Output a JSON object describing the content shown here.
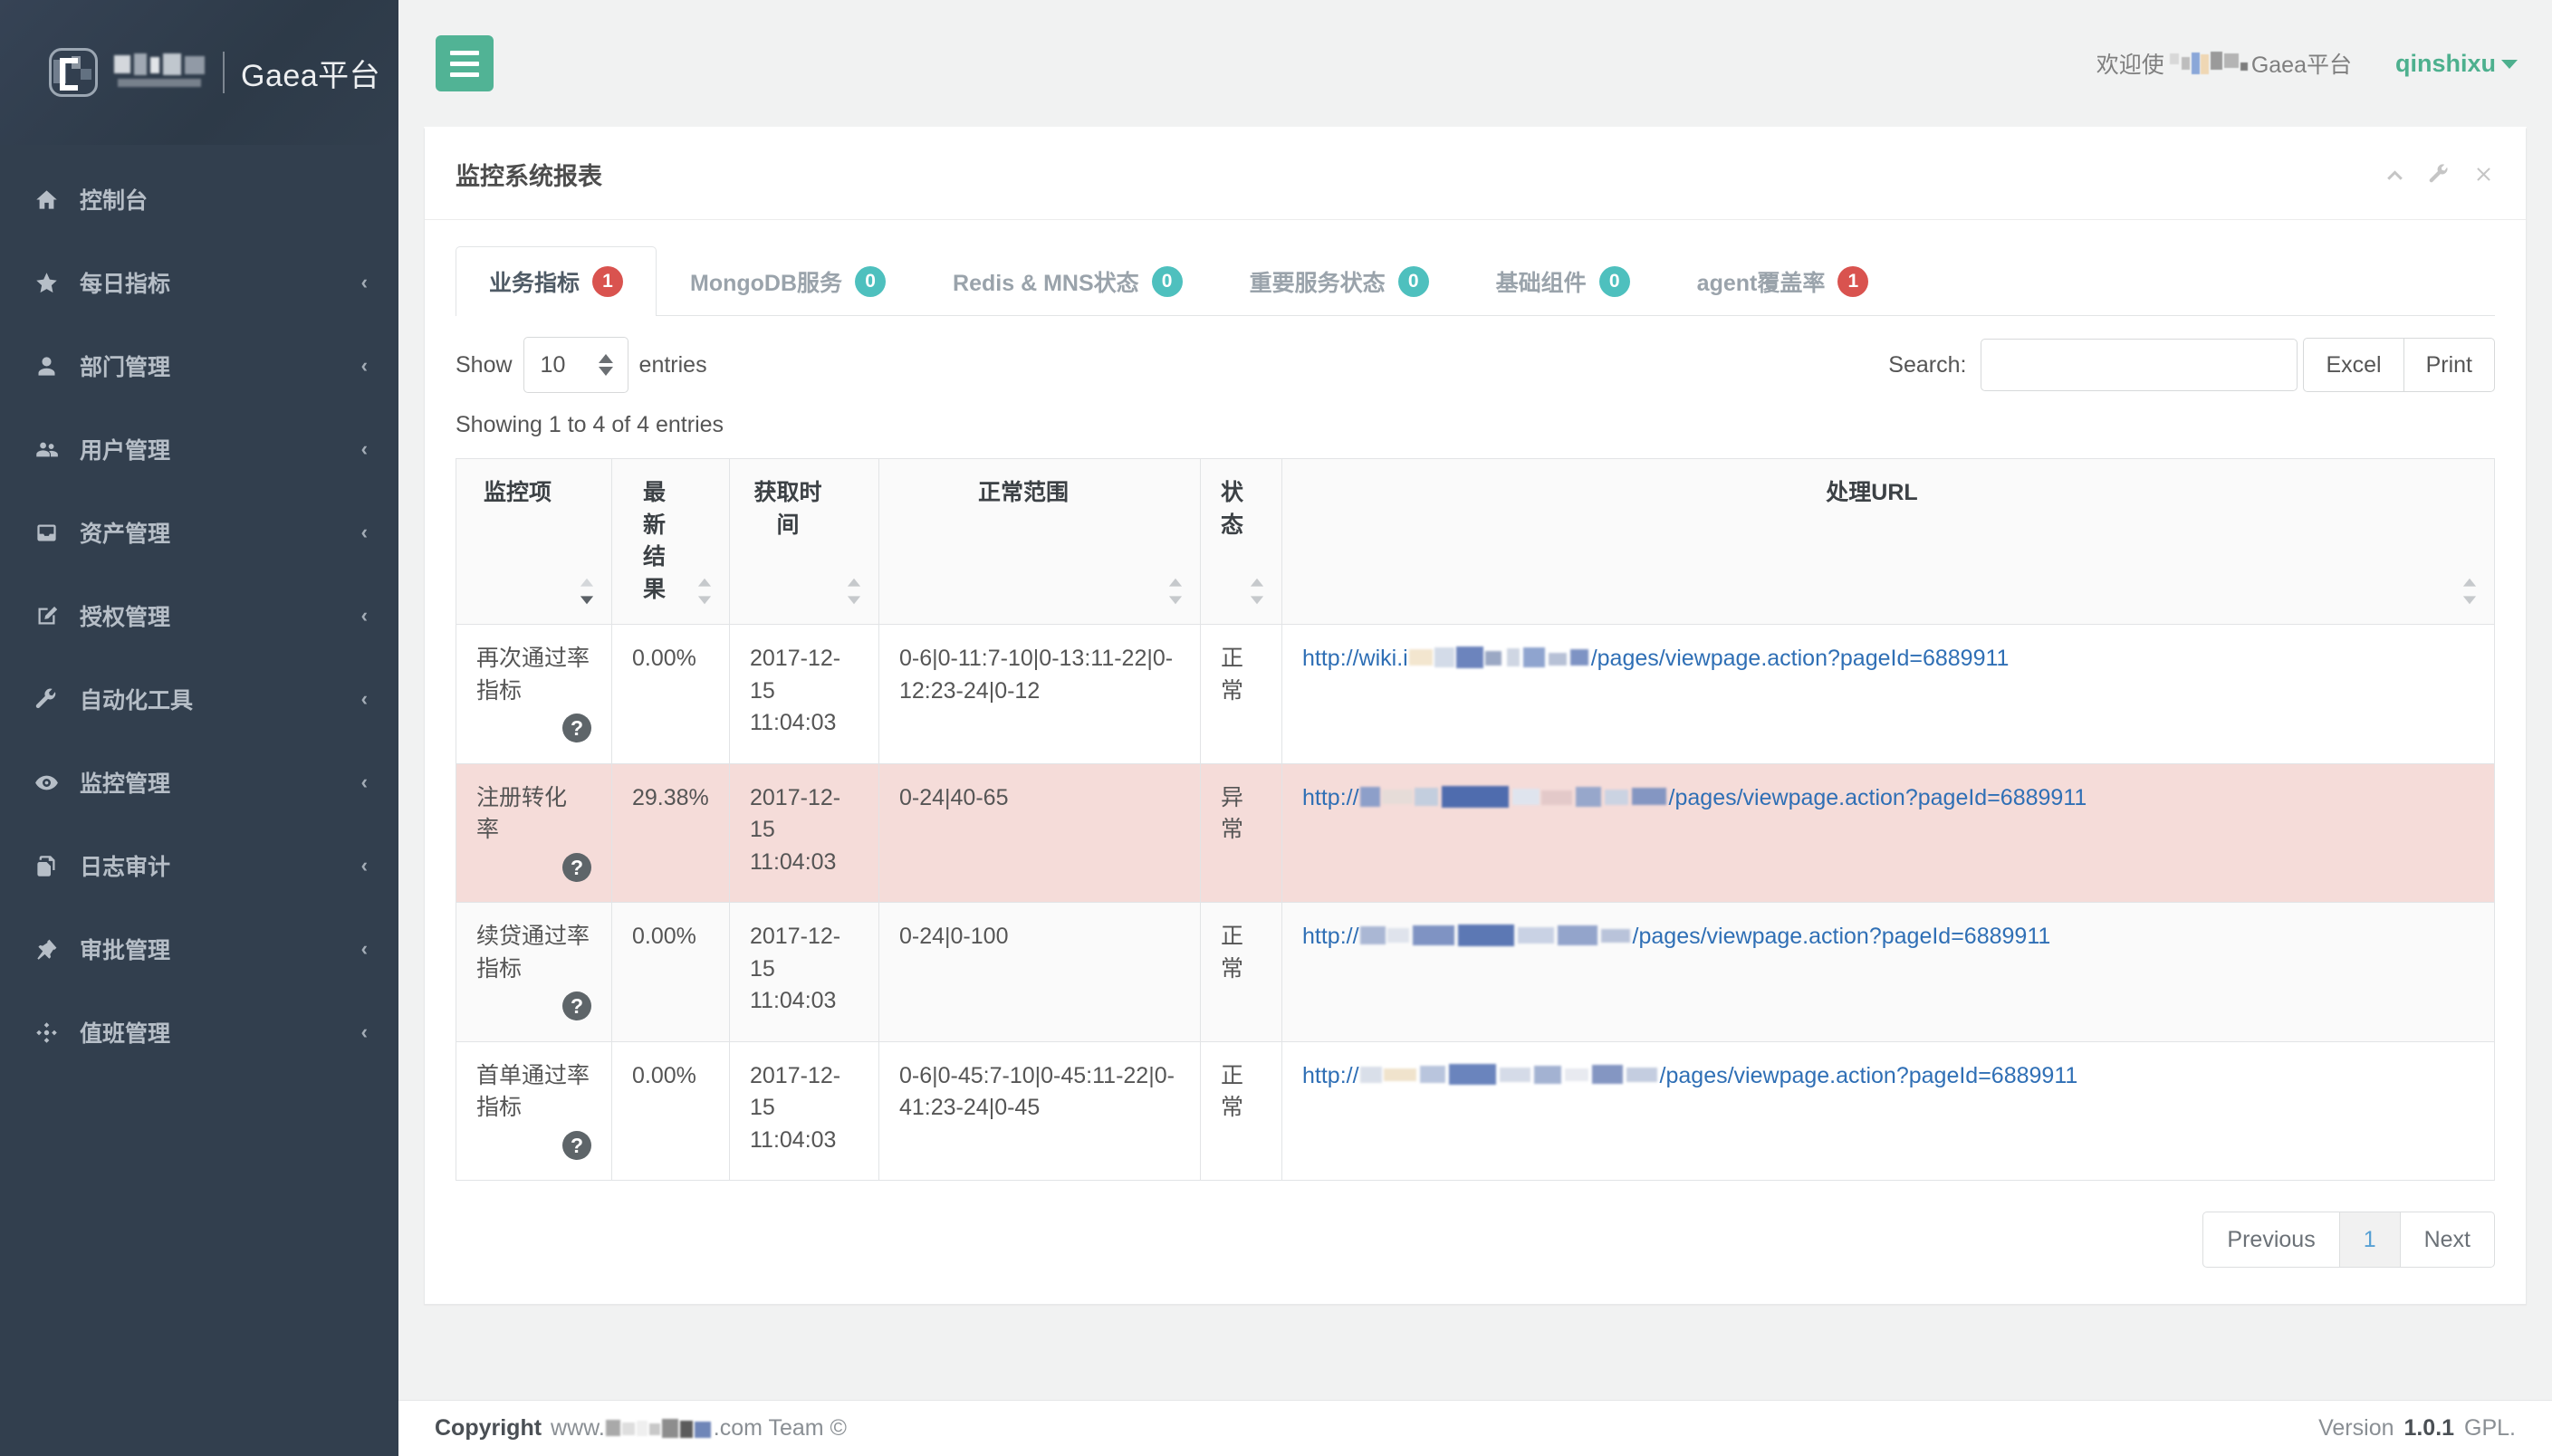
{
  "brand": {
    "name": "Gaea平台"
  },
  "sidebar": {
    "items": [
      {
        "label": "控制台",
        "icon": "home-icon",
        "expandable": false,
        "caret": ""
      },
      {
        "label": "每日指标",
        "icon": "star-icon",
        "expandable": true,
        "caret": "‹"
      },
      {
        "label": "部门管理",
        "icon": "user-icon",
        "expandable": true,
        "caret": "‹"
      },
      {
        "label": "用户管理",
        "icon": "users-icon",
        "expandable": true,
        "caret": "‹"
      },
      {
        "label": "资产管理",
        "icon": "inbox-icon",
        "expandable": true,
        "caret": "‹"
      },
      {
        "label": "授权管理",
        "icon": "edit-icon",
        "expandable": true,
        "caret": "‹"
      },
      {
        "label": "自动化工具",
        "icon": "wrench-icon",
        "expandable": true,
        "caret": "‹"
      },
      {
        "label": "监控管理",
        "icon": "eye-icon",
        "expandable": true,
        "caret": "‹"
      },
      {
        "label": "日志审计",
        "icon": "copy-icon",
        "expandable": true,
        "caret": "‹"
      },
      {
        "label": "审批管理",
        "icon": "pin-icon",
        "expandable": true,
        "caret": "‹"
      },
      {
        "label": "值班管理",
        "icon": "crosshair-icon",
        "expandable": true,
        "caret": "‹"
      }
    ]
  },
  "topbar": {
    "menu_toggle": "hamburger-icon",
    "welcome_prefix": "欢迎使",
    "welcome_suffix": "Gaea平台",
    "username": "qinshixu"
  },
  "panel": {
    "title": "监控系统报表",
    "tools": [
      {
        "name": "collapse-icon",
        "glyph": "chevron-up"
      },
      {
        "name": "settings-icon",
        "glyph": "wrench"
      },
      {
        "name": "close-icon",
        "glyph": "times"
      }
    ]
  },
  "tabs": [
    {
      "label": "业务指标",
      "count": "1",
      "badge": "red",
      "active": true
    },
    {
      "label": "MongoDB服务",
      "count": "0",
      "badge": "teal",
      "active": false
    },
    {
      "label": "Redis & MNS状态",
      "count": "0",
      "badge": "teal",
      "active": false
    },
    {
      "label": "重要服务状态",
      "count": "0",
      "badge": "teal",
      "active": false
    },
    {
      "label": "基础组件",
      "count": "0",
      "badge": "teal",
      "active": false
    },
    {
      "label": "agent覆盖率",
      "count": "1",
      "badge": "red",
      "active": false
    }
  ],
  "controls": {
    "show_label": "Show",
    "entries_label": "entries",
    "page_length": "10",
    "search_label": "Search:",
    "search_value": "",
    "search_placeholder": "",
    "excel_label": "Excel",
    "print_label": "Print",
    "info": "Showing 1 to 4 of 4 entries"
  },
  "table": {
    "columns": [
      {
        "label": "监控项",
        "sorted": true
      },
      {
        "label": "最新结果",
        "sorted": false
      },
      {
        "label": "获取时间",
        "sorted": false
      },
      {
        "label": "正常范围",
        "sorted": false
      },
      {
        "label": "状态",
        "sorted": false
      },
      {
        "label": "处理URL",
        "sorted": false
      }
    ],
    "rows": [
      {
        "name": "再次通过率指标",
        "help": "?",
        "result": "0.00%",
        "time": "2017-12-15 11:04:03",
        "range": "0-6|0-11:7-10|0-13:11-22|0-12:23-24|0-12",
        "status": "正常",
        "url_prefix": "http://wiki.i",
        "url_suffix": "/pages/viewpage.action?pageId=6889911",
        "style": "normal",
        "blur": "ub1"
      },
      {
        "name": "注册转化率",
        "help": "?",
        "result": "29.38%",
        "time": "2017-12-15 11:04:03",
        "range": "0-24|40-65",
        "status": "异常",
        "url_prefix": "http://",
        "url_suffix": "/pages/viewpage.action?pageId=6889911",
        "style": "danger",
        "blur": "ub2"
      },
      {
        "name": "续贷通过率指标",
        "help": "?",
        "result": "0.00%",
        "time": "2017-12-15 11:04:03",
        "range": "0-24|0-100",
        "status": "正常",
        "url_prefix": "http://",
        "url_suffix": "/pages/viewpage.action?pageId=6889911",
        "style": "alt",
        "blur": "ub3"
      },
      {
        "name": "首单通过率指标",
        "help": "?",
        "result": "0.00%",
        "time": "2017-12-15 11:04:03",
        "range": "0-6|0-45:7-10|0-45:11-22|0-41:23-24|0-45",
        "status": "正常",
        "url_prefix": "http://",
        "url_suffix": "/pages/viewpage.action?pageId=6889911",
        "style": "normal",
        "blur": "ub4"
      }
    ]
  },
  "pagination": {
    "previous": "Previous",
    "pages": [
      "1"
    ],
    "next": "Next",
    "current": "1"
  },
  "footer": {
    "copyright_label": "Copyright",
    "site_prefix": "www.",
    "site_suffix": ".com Team ©",
    "version_label": "Version",
    "version_number": "1.0.1",
    "license": "GPL."
  },
  "colors": {
    "sidebar": "#323f4e",
    "accent_green": "#51b395",
    "username_green": "#4db08e",
    "badge_red": "#d9534f",
    "badge_teal": "#4ec0be",
    "danger_row": "#f5dcd9",
    "link_blue": "#2f6fb5"
  }
}
